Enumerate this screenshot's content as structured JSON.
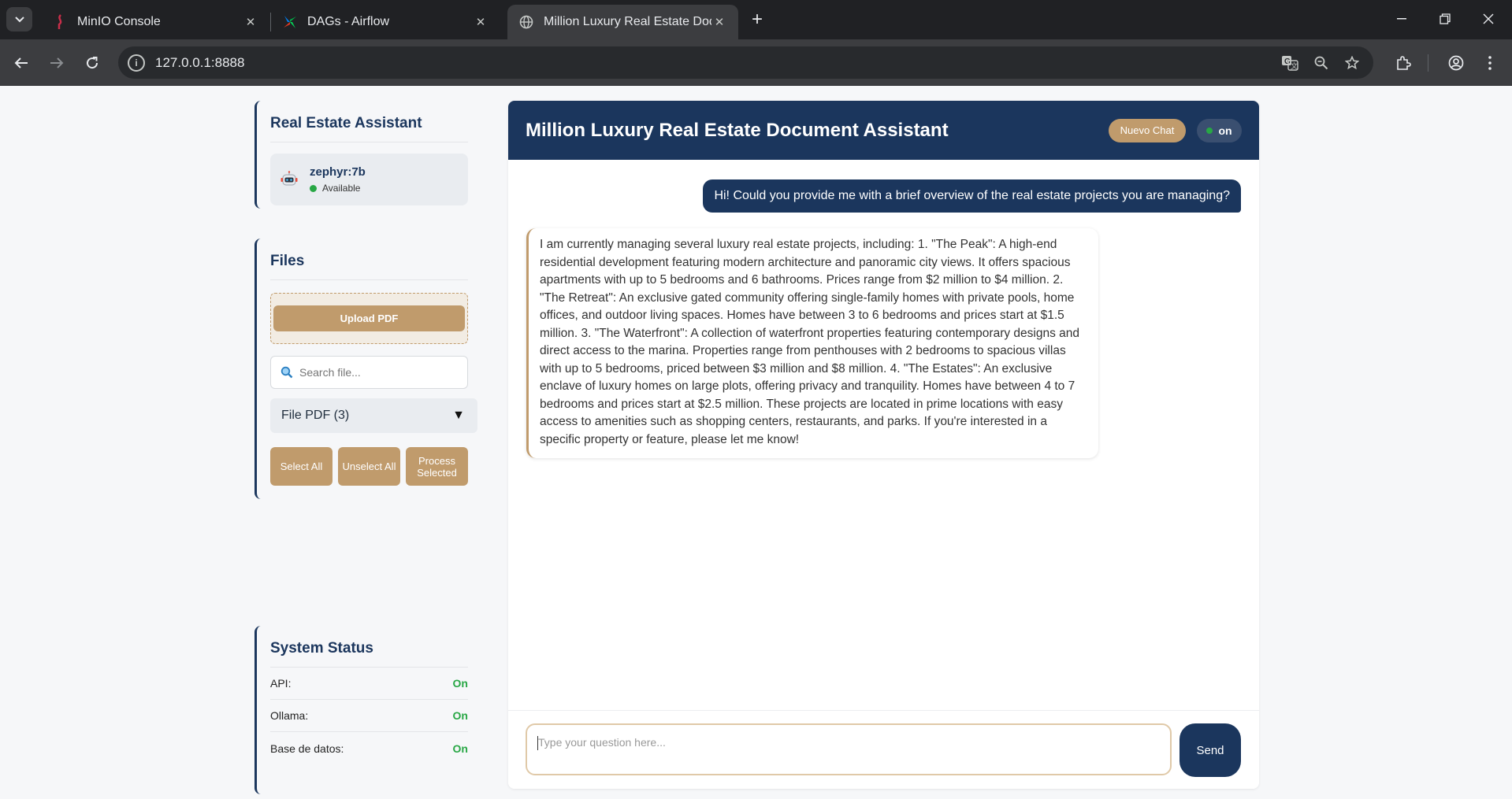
{
  "browser": {
    "tabs": [
      {
        "title": "MinIO Console",
        "favicon": "minio-icon"
      },
      {
        "title": "DAGs - Airflow",
        "favicon": "airflow-icon"
      },
      {
        "title": "Million Luxury Real Estate Docu",
        "favicon": "globe-icon"
      }
    ],
    "url": "127.0.0.1:8888"
  },
  "sidebar": {
    "assistant": {
      "heading": "Real Estate Assistant",
      "model_name": "zephyr:7b",
      "model_status": "Available"
    },
    "files": {
      "heading": "Files",
      "upload_label": "Upload PDF",
      "search_placeholder": "Search file...",
      "selected_filter": "File PDF (3)",
      "select_all": "Select All",
      "unselect_all": "Unselect All",
      "process_selected": "Process Selected"
    },
    "system_status": {
      "heading": "System Status",
      "rows": [
        {
          "label": "API:",
          "value": "On"
        },
        {
          "label": "Ollama:",
          "value": "On"
        },
        {
          "label": "Base de datos:",
          "value": "On"
        }
      ]
    }
  },
  "chat": {
    "title": "Million Luxury Real Estate Document Assistant",
    "new_chat": "Nuevo Chat",
    "status": "on",
    "messages": [
      {
        "role": "user",
        "text": "Hi! Could you provide me with a brief overview of the real estate projects you are managing?"
      },
      {
        "role": "assistant",
        "text": "I am currently managing several luxury real estate projects, including: 1. \"The Peak\": A high-end residential development featuring modern architecture and panoramic city views. It offers spacious apartments with up to 5 bedrooms and 6 bathrooms. Prices range from $2 million to $4 million. 2. \"The Retreat\": An exclusive gated community offering single-family homes with private pools, home offices, and outdoor living spaces. Homes have between 3 to 6 bedrooms and prices start at $1.5 million. 3. \"The Waterfront\": A collection of waterfront properties featuring contemporary designs and direct access to the marina. Properties range from penthouses with 2 bedrooms to spacious villas with up to 5 bedrooms, priced between $3 million and $8 million. 4. \"The Estates\": An exclusive enclave of luxury homes on large plots, offering privacy and tranquility. Homes have between 4 to 7 bedrooms and prices start at $2.5 million. These projects are located in prime locations with easy access to amenities such as shopping centers, restaurants, and parks. If you're interested in a specific property or feature, please let me know!"
      }
    ],
    "input_placeholder": "Type your question here...",
    "send_label": "Send"
  },
  "colors": {
    "navy": "#1b365d",
    "gold": "#c09b6c",
    "status_green": "#28a745"
  }
}
